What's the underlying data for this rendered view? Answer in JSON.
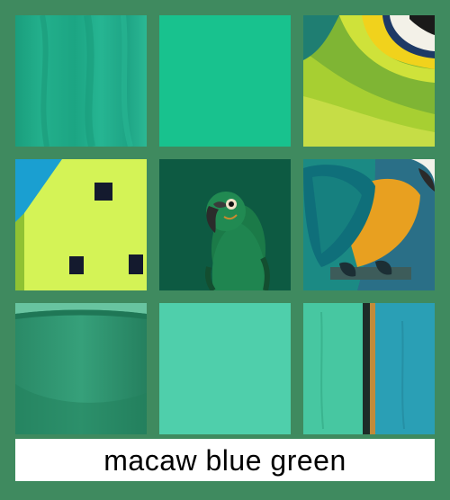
{
  "caption": "macaw blue green",
  "palette": {
    "background": "#3f8a5f",
    "caption_bg": "#ffffff",
    "caption_text": "#000000"
  },
  "swatches": [
    {
      "name": "teal-fabric",
      "color": "#1fab87"
    },
    {
      "name": "solid-green",
      "color": "#18c28e"
    },
    {
      "name": "parrot-feathers",
      "color": "#a6cf2e"
    },
    {
      "name": "lime-house",
      "color": "#d7f24a"
    },
    {
      "name": "green-parrot",
      "color": "#0c5c42"
    },
    {
      "name": "blue-gold-macaw",
      "color": "#1b8a84"
    },
    {
      "name": "green-mug",
      "color": "#2f9470"
    },
    {
      "name": "solid-aqua",
      "color": "#4fcfab"
    },
    {
      "name": "painted-wood",
      "color": "#3fc39b"
    }
  ]
}
